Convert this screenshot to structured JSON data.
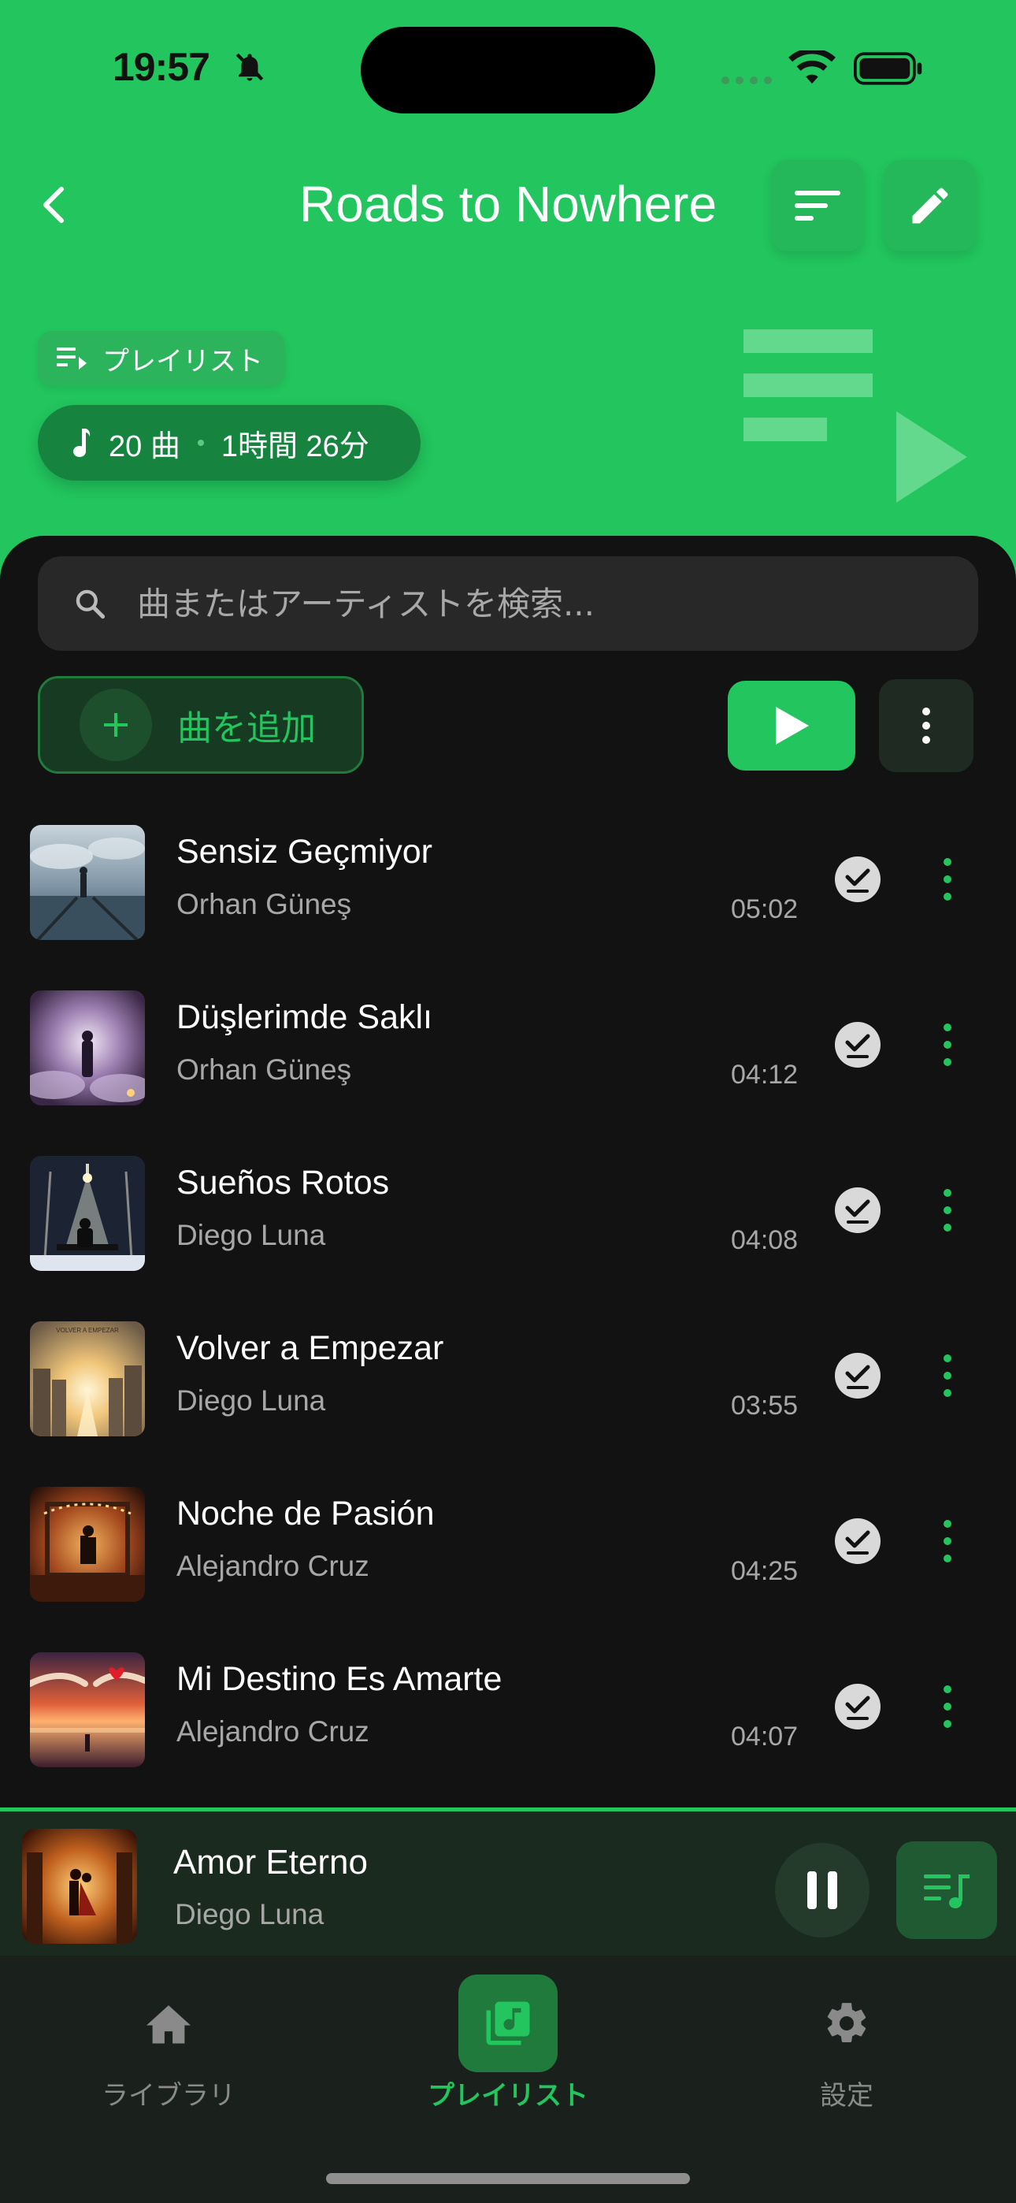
{
  "status_bar": {
    "time": "19:57"
  },
  "header": {
    "title": "Roads to Nowhere",
    "badge_label": "プレイリスト",
    "track_count": "20 曲",
    "duration": "1時間 26分"
  },
  "search": {
    "placeholder": "曲またはアーティストを検索..."
  },
  "actions": {
    "add_label": "曲を追加"
  },
  "tracks": [
    {
      "title": "Sensiz Geçmiyor",
      "artist": "Orhan Güneş",
      "duration": "05:02"
    },
    {
      "title": "Düşlerimde Saklı",
      "artist": "Orhan Güneş",
      "duration": "04:12"
    },
    {
      "title": "Sueños Rotos",
      "artist": "Diego Luna",
      "duration": "04:08"
    },
    {
      "title": "Volver a Empezar",
      "artist": "Diego Luna",
      "duration": "03:55"
    },
    {
      "title": "Noche de Pasión",
      "artist": "Alejandro Cruz",
      "duration": "04:25"
    },
    {
      "title": "Mi Destino Es Amarte",
      "artist": "Alejandro Cruz",
      "duration": "04:07"
    }
  ],
  "art_labels": {
    "track_4": "VOLVER A EMPEZAR"
  },
  "now_playing": {
    "title": "Amor Eterno",
    "artist": "Diego Luna"
  },
  "tabs": [
    {
      "label": "ライブラリ",
      "icon": "home-icon"
    },
    {
      "label": "プレイリスト",
      "icon": "playlist-icon"
    },
    {
      "label": "設定",
      "icon": "gear-icon"
    }
  ],
  "colors": {
    "accent": "#22c55e",
    "background": "#121212",
    "header": "#22c55e"
  }
}
